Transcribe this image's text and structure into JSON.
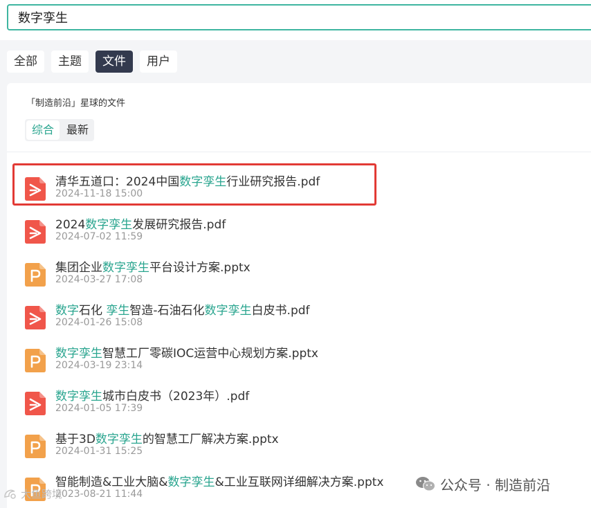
{
  "search": {
    "value": "数字孪生"
  },
  "tabs": [
    {
      "label": "全部",
      "active": false
    },
    {
      "label": "主题",
      "active": false
    },
    {
      "label": "文件",
      "active": true
    },
    {
      "label": "用户",
      "active": false
    }
  ],
  "panel": {
    "title": "「制造前沿」星球的文件",
    "sort": [
      {
        "label": "综合",
        "active": true
      },
      {
        "label": "最新",
        "active": false
      }
    ]
  },
  "files": [
    {
      "type": "pdf",
      "name_parts": [
        [
          "清华五道口：2024中国",
          false
        ],
        [
          "数字孪生",
          true
        ],
        [
          "行业研究报告.pdf",
          false
        ]
      ],
      "date": "2024-11-18 15:00"
    },
    {
      "type": "pdf",
      "name_parts": [
        [
          "2024",
          false
        ],
        [
          "数字孪生",
          true
        ],
        [
          "发展研究报告.pdf",
          false
        ]
      ],
      "date": "2024-07-02 11:59"
    },
    {
      "type": "ppt",
      "name_parts": [
        [
          "集团企业",
          false
        ],
        [
          "数字孪生",
          true
        ],
        [
          "平台设计方案.pptx",
          false
        ]
      ],
      "date": "2024-03-27 17:08"
    },
    {
      "type": "pdf",
      "name_parts": [
        [
          "数字",
          true
        ],
        [
          "石化 ",
          false
        ],
        [
          "孪生",
          true
        ],
        [
          "智造-石油石化",
          false
        ],
        [
          "数字孪生",
          true
        ],
        [
          "白皮书.pdf",
          false
        ]
      ],
      "date": "2024-01-26 15:08"
    },
    {
      "type": "ppt",
      "name_parts": [
        [
          "数字孪生",
          true
        ],
        [
          "智慧工厂零碳IOC运营中心规划方案.pptx",
          false
        ]
      ],
      "date": "2024-03-19 23:14"
    },
    {
      "type": "pdf",
      "name_parts": [
        [
          "数字孪生",
          true
        ],
        [
          "城市白皮书（2023年）.pdf",
          false
        ]
      ],
      "date": "2024-01-05 17:39"
    },
    {
      "type": "ppt",
      "name_parts": [
        [
          "基于3D",
          false
        ],
        [
          "数字孪生",
          true
        ],
        [
          "的智慧工厂解决方案.pptx",
          false
        ]
      ],
      "date": "2024-01-31 15:25"
    },
    {
      "type": "ppt",
      "name_parts": [
        [
          "智能制造&工业大脑&",
          false
        ],
        [
          "数字孪生",
          true
        ],
        [
          "&工业互联网详细解决方案.pptx",
          false
        ]
      ],
      "date": "2023-08-21 11:44"
    }
  ],
  "watermark": {
    "text": "公众号 · 制造前沿",
    "icon": "wechat-icon"
  },
  "watermark2": {
    "text": "大鱼跨境",
    "icon": "logo-icon"
  },
  "colors": {
    "accent": "#2aa58f",
    "pdf": "#f0564a",
    "ppt": "#f2a14b",
    "tab_active_bg": "#333a4e",
    "highlight_border": "#e23a35"
  }
}
